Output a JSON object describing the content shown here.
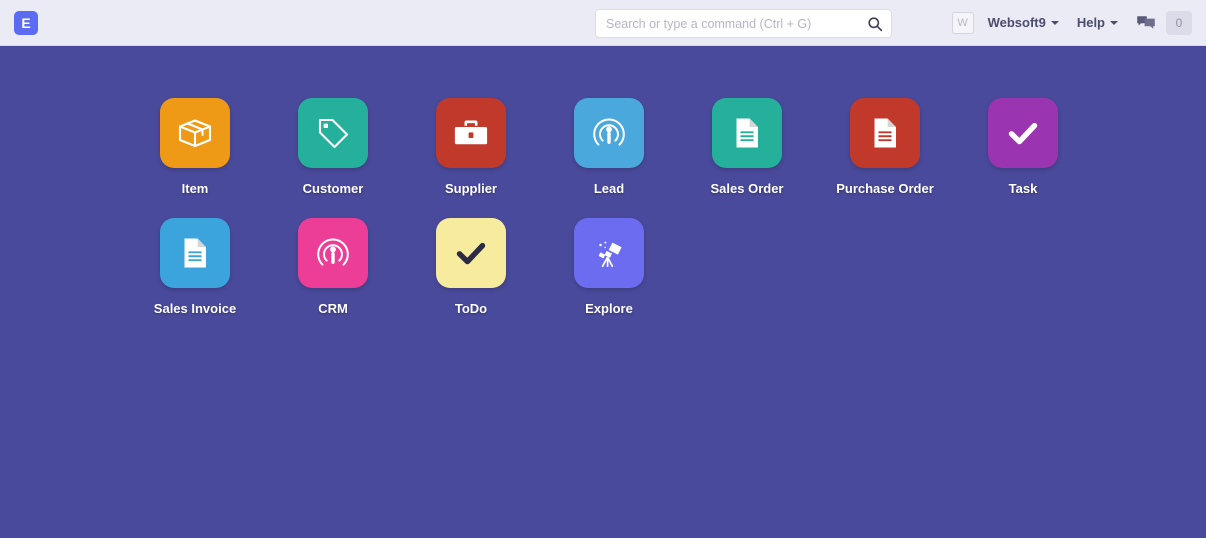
{
  "colors": {
    "desktop_bg": "#4a4a9c",
    "navbar_bg": "#ebebf5",
    "logo_bg": "#5c6cf2",
    "label_color": "#ffffff"
  },
  "navbar": {
    "logo_letter": "E",
    "search": {
      "placeholder": "Search or type a command (Ctrl + G)",
      "value": ""
    },
    "avatar_letter": "W",
    "user_menu_label": "Websoft9",
    "help_menu_label": "Help",
    "chat_icon": "chat-bubbles-icon",
    "notification_count": "0"
  },
  "desktop": {
    "icons": [
      {
        "label": "Item",
        "icon": "box-icon",
        "color": "#ef9a16"
      },
      {
        "label": "Customer",
        "icon": "tag-icon",
        "color": "#25b09b"
      },
      {
        "label": "Supplier",
        "icon": "briefcase-icon",
        "color": "#c0392b"
      },
      {
        "label": "Lead",
        "icon": "broadcast-person-icon",
        "color": "#4aa8dd"
      },
      {
        "label": "Sales Order",
        "icon": "document-icon",
        "color": "#25b09b"
      },
      {
        "label": "Purchase Order",
        "icon": "document-icon",
        "color": "#c0392b"
      },
      {
        "label": "Task",
        "icon": "check-icon",
        "color": "#9b34b0"
      },
      {
        "label": "Sales Invoice",
        "icon": "document-icon",
        "color": "#3ba4dd"
      },
      {
        "label": "CRM",
        "icon": "broadcast-person-icon",
        "color": "#ec3e97"
      },
      {
        "label": "ToDo",
        "icon": "check-icon",
        "color": "#f7eb9e"
      },
      {
        "label": "Explore",
        "icon": "telescope-icon",
        "color": "#6c6cf0"
      }
    ]
  }
}
